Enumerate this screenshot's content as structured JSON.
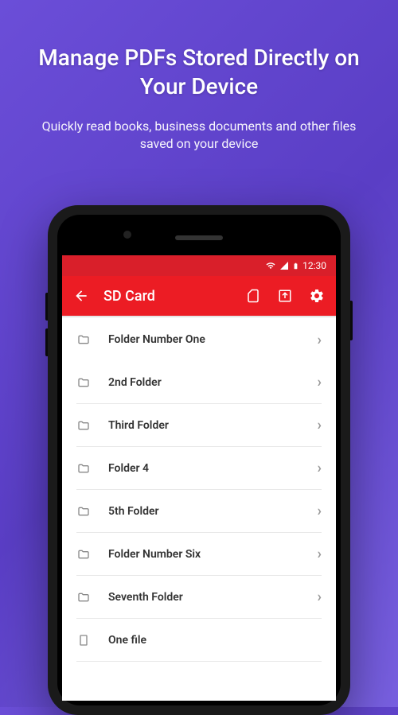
{
  "hero": {
    "title": "Manage PDFs Stored Directly on Your Device",
    "subtitle": "Quickly read books, business documents and other files saved on your device"
  },
  "status": {
    "time": "12:30"
  },
  "appbar": {
    "title": "SD Card"
  },
  "items": [
    {
      "type": "folder",
      "label": "Folder Number One",
      "chevron": true
    },
    {
      "type": "folder",
      "label": "2nd Folder",
      "chevron": true
    },
    {
      "type": "folder",
      "label": "Third Folder",
      "chevron": true
    },
    {
      "type": "folder",
      "label": "Folder 4",
      "chevron": true
    },
    {
      "type": "folder",
      "label": "5th Folder",
      "chevron": true
    },
    {
      "type": "folder",
      "label": "Folder Number Six",
      "chevron": true
    },
    {
      "type": "folder",
      "label": "Seventh Folder",
      "chevron": true
    },
    {
      "type": "file",
      "label": "One file",
      "chevron": false
    }
  ]
}
